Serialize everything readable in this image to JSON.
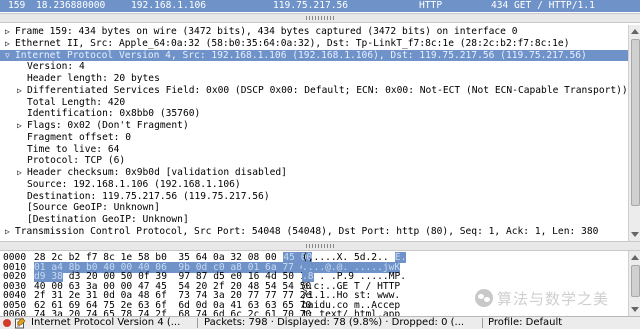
{
  "packet_row": {
    "no": "159",
    "time": "18.236880000",
    "source": "192.168.1.106",
    "destination": "119.75.217.56",
    "protocol": "HTTP",
    "length": "434",
    "info": "GET / HTTP/1.1"
  },
  "details": [
    {
      "expander": "▷",
      "indent": 0,
      "text": "Frame 159: 434 bytes on wire (3472 bits), 434 bytes captured (3472 bits) on interface 0",
      "selected": false
    },
    {
      "expander": "▷",
      "indent": 0,
      "text": "Ethernet II, Src: Apple_64:0a:32 (58:b0:35:64:0a:32), Dst: Tp-LinkT_f7:8c:1e (28:2c:b2:f7:8c:1e)",
      "selected": false
    },
    {
      "expander": "▽",
      "indent": 0,
      "text": "Internet Protocol Version 4, Src: 192.168.1.106 (192.168.1.106), Dst: 119.75.217.56 (119.75.217.56)",
      "selected": true
    },
    {
      "expander": "",
      "indent": 1,
      "text": "Version: 4",
      "selected": false
    },
    {
      "expander": "",
      "indent": 1,
      "text": "Header length: 20 bytes",
      "selected": false
    },
    {
      "expander": "▷",
      "indent": 1,
      "text": "Differentiated Services Field: 0x00 (DSCP 0x00: Default; ECN: 0x00: Not-ECT (Not ECN-Capable Transport))",
      "selected": false
    },
    {
      "expander": "",
      "indent": 1,
      "text": "Total Length: 420",
      "selected": false
    },
    {
      "expander": "",
      "indent": 1,
      "text": "Identification: 0x8bb0 (35760)",
      "selected": false
    },
    {
      "expander": "▷",
      "indent": 1,
      "text": "Flags: 0x02 (Don't Fragment)",
      "selected": false
    },
    {
      "expander": "",
      "indent": 1,
      "text": "Fragment offset: 0",
      "selected": false
    },
    {
      "expander": "",
      "indent": 1,
      "text": "Time to live: 64",
      "selected": false
    },
    {
      "expander": "",
      "indent": 1,
      "text": "Protocol: TCP (6)",
      "selected": false
    },
    {
      "expander": "▷",
      "indent": 1,
      "text": "Header checksum: 0x9b0d [validation disabled]",
      "selected": false
    },
    {
      "expander": "",
      "indent": 1,
      "text": "Source: 192.168.1.106 (192.168.1.106)",
      "selected": false
    },
    {
      "expander": "",
      "indent": 1,
      "text": "Destination: 119.75.217.56 (119.75.217.56)",
      "selected": false
    },
    {
      "expander": "",
      "indent": 1,
      "text": "[Source GeoIP: Unknown]",
      "selected": false
    },
    {
      "expander": "",
      "indent": 1,
      "text": "[Destination GeoIP: Unknown]",
      "selected": false
    },
    {
      "expander": "▷",
      "indent": 0,
      "text": "Transmission Control Protocol, Src Port: 54048 (54048), Dst Port: http (80), Seq: 1, Ack: 1, Len: 380",
      "selected": false
    }
  ],
  "bytes": [
    {
      "offset": "0000",
      "hex": [
        "28 2c b2 f7 8c 1e 58 b0  35 64 0a 32 08 00",
        "45 00"
      ],
      "ascii": [
        "(,....X. 5d.2..",
        "E."
      ]
    },
    {
      "offset": "0010",
      "hex": [
        "01 a4 8b b0 40 00 40 06  9b 0d c0 a8 01 6a 77 4b"
      ],
      "ascii": [
        "....@.@. .....jwK"
      ],
      "full_highlight": true
    },
    {
      "offset": "0020",
      "hex": [
        "d9 38",
        "d3 20 00 50 0f 39  97 87 d5 e0 16 4d 50 18"
      ],
      "ascii": [
        ".8",
        ". .P.9 .....MP."
      ],
      "head_highlight": true
    },
    {
      "offset": "0030",
      "hex": [
        "40 00 63 3a 00 00 47 45  54 20 2f 20 48 54 54 50"
      ],
      "ascii": [
        "@.c:..GE T / HTTP"
      ]
    },
    {
      "offset": "0040",
      "hex": [
        "2f 31 2e 31 0d 0a 48 6f  73 74 3a 20 77 77 77 2e"
      ],
      "ascii": [
        "/1.1..Ho st: www."
      ]
    },
    {
      "offset": "0050",
      "hex": [
        "62 61 69 64 75 2e 63 6f  6d 0d 0a 41 63 63 65 70"
      ],
      "ascii": [
        "baidu.co m..Accep"
      ]
    },
    {
      "offset": "0060",
      "hex": [
        "74 3a 20 74 65 78 74 2f  68 74 6d 6c 2c 61 70 70"
      ],
      "ascii": [
        "t: text/ html,app"
      ]
    }
  ],
  "status": {
    "field_label": "Internet Protocol Version 4 (...",
    "packets": "Packets: 798 · Displayed: 78 (9.8%) · Dropped: 0 (...",
    "profile": "Profile: Default"
  },
  "watermark": {
    "text": "算法与数学之美"
  },
  "colors": {
    "selection": "#6f93c9",
    "background": "#ffffff"
  }
}
